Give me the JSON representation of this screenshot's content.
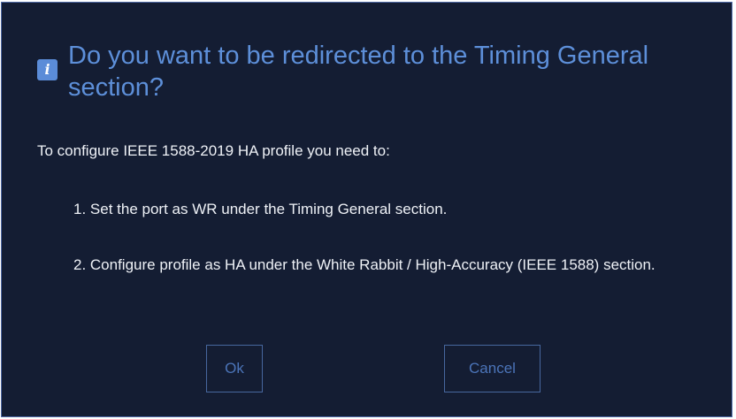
{
  "dialog": {
    "icon": "info-icon",
    "icon_glyph": "i",
    "title": "Do you want to be redirected to the Timing General section?",
    "intro": "To configure IEEE 1588-2019 HA profile you need to:",
    "steps": [
      "1. Set the port as WR under the Timing General section.",
      "2. Configure profile as HA under the White Rabbit / High-Accuracy (IEEE 1588) section."
    ],
    "buttons": {
      "ok_label": "Ok",
      "cancel_label": "Cancel"
    }
  },
  "colors": {
    "background": "#141d33",
    "border": "#4f6aa6",
    "title": "#5d8fd9",
    "icon": "#5b8cd8",
    "button_text": "#4b74b8",
    "body_text": "#eef1f6"
  }
}
